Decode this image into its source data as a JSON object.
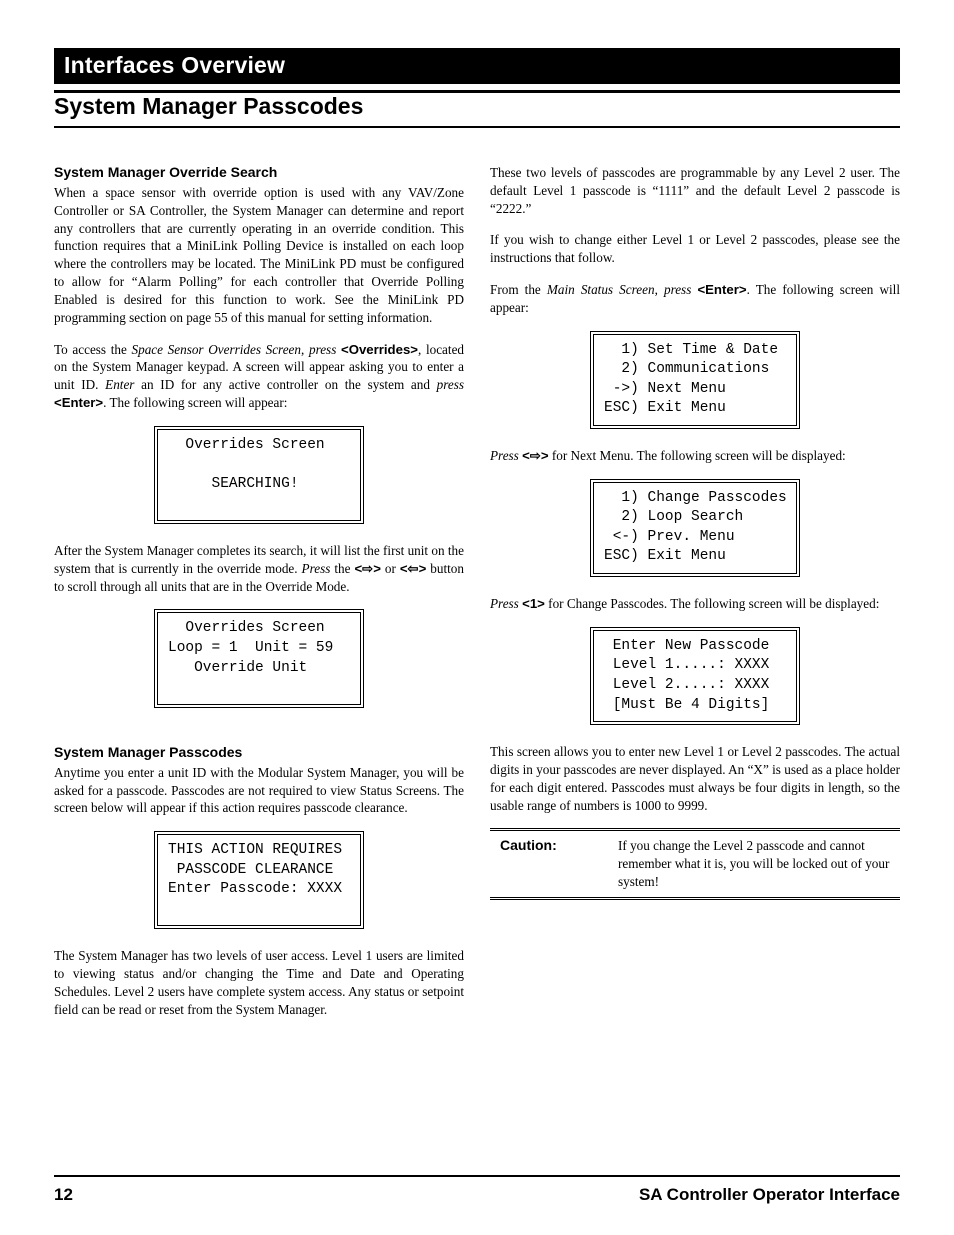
{
  "header": {
    "bar": "Interfaces Overview",
    "title": "System Manager Passcodes"
  },
  "left": {
    "h1": "System Manager Override Search",
    "p1": "When a space sensor with override option is used with any VAV/Zone Controller or SA Controller, the System Manager can determine and report any controllers that are currently operating in an override condition. This function requires that a MiniLink Polling Device is installed on each loop where the controllers may be located. The MiniLink PD must be configured to allow for “Alarm Polling” for each controller that Override Polling Enabled is desired for this function to work. See the MiniLink PD programming section on page 55 of this manual for setting information.",
    "p2a": "To access the ",
    "p2i": "Space Sensor Overrides Screen",
    "p2b": ", ",
    "p2pr": "press",
    "p2c": " ",
    "p2key": "<Overrides>",
    "p2d": ", located on the System Manager keypad. A screen will appear asking you to enter a unit ID. ",
    "p2e": "Enter",
    "p2f": " an ID for any active controller on the system and ",
    "p2pr2": "press",
    "p2g": " ",
    "p2key2": "<Enter>",
    "p2h": ". The following screen will appear:",
    "screen1": "  Overrides Screen\n\n     SEARCHING!\n ",
    "p3a": "After the System Manager completes its search, it will list the first unit on the system that is currently in the override mode. ",
    "p3pr": "Press",
    "p3b": " the ",
    "p3key1": "<⇨>",
    "p3c": " or ",
    "p3key2": "<⇦>",
    "p3d": " button to scroll through all units that are in the Override Mode.",
    "screen2": "  Overrides Screen\nLoop = 1  Unit = 59\n   Override Unit\n ",
    "h2": "System Manager Passcodes",
    "p4": "Anytime you enter a unit ID with the Modular System Manager, you will be asked for a passcode. Passcodes are not required to view Status Screens. The screen below will appear if this action requires passcode clearance.",
    "screen3": "THIS ACTION REQUIRES\n PASSCODE CLEARANCE\nEnter Passcode: XXXX\n ",
    "p5": "The System Manager has two levels of user access. Level 1 users are limited to viewing status and/or changing the Time and Date and Operating Schedules. Level 2 users have complete system access. Any status or setpoint field can be read or reset from the System Manager."
  },
  "right": {
    "p1": "These two levels of passcodes are programmable by any Level 2 user. The default Level 1 passcode is “1111” and the default Level 2 passcode is “2222.”",
    "p2": "If you wish to change either Level 1 or Level 2 passcodes, please see the instructions that follow.",
    "p3a": "From the ",
    "p3i": "Main Status Screen",
    "p3b": ", ",
    "p3pr": "press",
    "p3c": " ",
    "p3key": "<Enter>",
    "p3d": ". The following screen will appear:",
    "screen1": "  1) Set Time & Date\n  2) Communications\n ->) Next Menu\nESC) Exit Menu",
    "p4pr": "Press",
    "p4a": " ",
    "p4key": "<⇨>",
    "p4b": " for Next Menu. The following screen will be displayed:",
    "screen2": "  1) Change Passcodes\n  2) Loop Search\n <-) Prev. Menu\nESC) Exit Menu",
    "p5pr": "Press",
    "p5a": " ",
    "p5key": "<1>",
    "p5b": " for Change Passcodes. The following screen will be displayed:",
    "screen3": " Enter New Passcode\n Level 1.....: XXXX\n Level 2.....: XXXX\n [Must Be 4 Digits]",
    "p6": "This screen allows you to enter new Level 1 or Level 2 passcodes. The actual digits in your passcodes are never displayed. An “X” is used as a place holder for each digit entered. Passcodes must always be four digits in length, so the usable range of numbers is 1000 to 9999.",
    "caution_label": "Caution:",
    "caution_text": "If you change the Level 2 passcode and cannot remember what it is, you will be locked out of your system!"
  },
  "footer": {
    "page": "12",
    "doc": "SA Controller Operator Interface"
  }
}
